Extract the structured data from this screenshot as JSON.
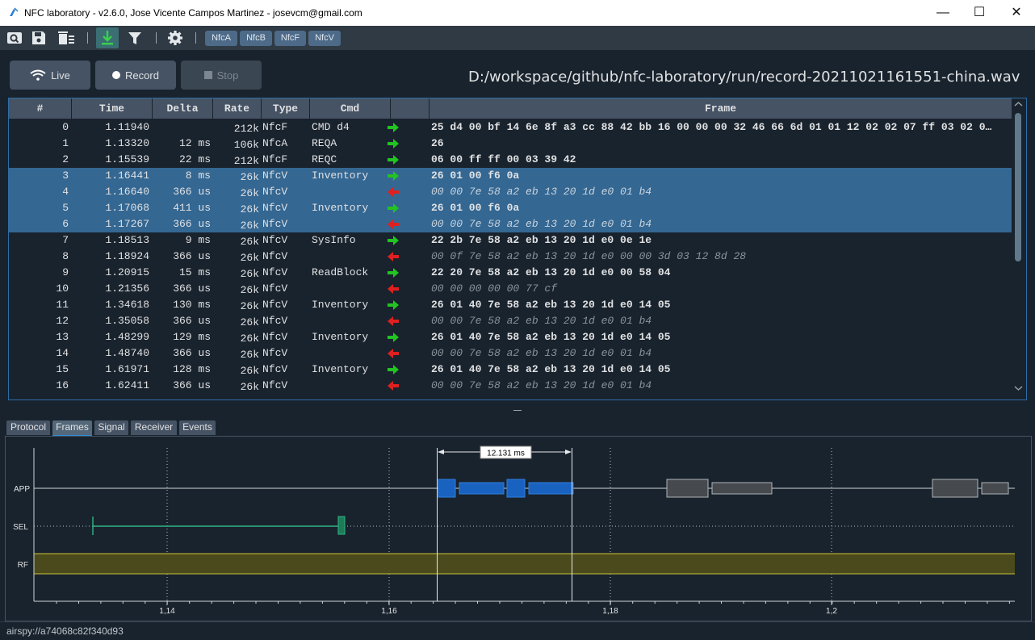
{
  "window": {
    "title": "NFC laboratory - v2.6.0, Jose Vicente Campos Martinez - josevcm@gmail.com",
    "minimize": "—",
    "maximize": "☐",
    "close": "✕"
  },
  "toolbar": {
    "chips": [
      "NfcA",
      "NfcB",
      "NfcF",
      "NfcV"
    ]
  },
  "controls": {
    "live": "Live",
    "record": "Record",
    "stop": "Stop"
  },
  "file_path": "D:/workspace/github/nfc-laboratory/run/record-20211021161551-china.wav",
  "table": {
    "headers": [
      "#",
      "Time",
      "Delta",
      "Rate",
      "Type",
      "Cmd",
      "",
      "Frame"
    ],
    "rows": [
      {
        "num": "0",
        "time": "1.11940",
        "delta": "",
        "rate": "212k",
        "type": "NfcF",
        "cmd": "CMD d4",
        "dir": "out",
        "frame": "25 d4 00 bf 14 6e 8f a3 cc 88 42 bb 16 00 00 00 32 46 66 6d 01 01 12 02 02 07 ff 03 02 0…",
        "selected": false
      },
      {
        "num": "1",
        "time": "1.13320",
        "delta": "12 ms",
        "rate": "106k",
        "type": "NfcA",
        "cmd": "REQA",
        "dir": "out",
        "frame": "26",
        "selected": false
      },
      {
        "num": "2",
        "time": "1.15539",
        "delta": "22 ms",
        "rate": "212k",
        "type": "NfcF",
        "cmd": "REQC",
        "dir": "out",
        "frame": "06 00 ff ff 00 03 39 42",
        "selected": false
      },
      {
        "num": "3",
        "time": "1.16441",
        "delta": "8 ms",
        "rate": "26k",
        "type": "NfcV",
        "cmd": "Inventory",
        "dir": "out",
        "frame": "26 01 00 f6 0a",
        "selected": true
      },
      {
        "num": "4",
        "time": "1.16640",
        "delta": "366 us",
        "rate": "26k",
        "type": "NfcV",
        "cmd": "",
        "dir": "in",
        "frame": "00 00 7e 58 a2 eb 13 20 1d e0 01 b4",
        "selected": true
      },
      {
        "num": "5",
        "time": "1.17068",
        "delta": "411 us",
        "rate": "26k",
        "type": "NfcV",
        "cmd": "Inventory",
        "dir": "out",
        "frame": "26 01 00 f6 0a",
        "selected": true
      },
      {
        "num": "6",
        "time": "1.17267",
        "delta": "366 us",
        "rate": "26k",
        "type": "NfcV",
        "cmd": "",
        "dir": "in",
        "frame": "00 00 7e 58 a2 eb 13 20 1d e0 01 b4",
        "selected": true
      },
      {
        "num": "7",
        "time": "1.18513",
        "delta": "9 ms",
        "rate": "26k",
        "type": "NfcV",
        "cmd": "SysInfo",
        "dir": "out",
        "frame": "22 2b 7e 58 a2 eb 13 20 1d e0 0e 1e",
        "selected": false
      },
      {
        "num": "8",
        "time": "1.18924",
        "delta": "366 us",
        "rate": "26k",
        "type": "NfcV",
        "cmd": "",
        "dir": "in",
        "frame": "00 0f 7e 58 a2 eb 13 20 1d e0 00 00 3d 03 12 8d 28",
        "selected": false
      },
      {
        "num": "9",
        "time": "1.20915",
        "delta": "15 ms",
        "rate": "26k",
        "type": "NfcV",
        "cmd": "ReadBlock",
        "dir": "out",
        "frame": "22 20 7e 58 a2 eb 13 20 1d e0 00 58 04",
        "selected": false
      },
      {
        "num": "10",
        "time": "1.21356",
        "delta": "366 us",
        "rate": "26k",
        "type": "NfcV",
        "cmd": "",
        "dir": "in",
        "frame": "00 00 00 00 00 77 cf",
        "selected": false
      },
      {
        "num": "11",
        "time": "1.34618",
        "delta": "130 ms",
        "rate": "26k",
        "type": "NfcV",
        "cmd": "Inventory",
        "dir": "out",
        "frame": "26 01 40 7e 58 a2 eb 13 20 1d e0 14 05",
        "selected": false
      },
      {
        "num": "12",
        "time": "1.35058",
        "delta": "366 us",
        "rate": "26k",
        "type": "NfcV",
        "cmd": "",
        "dir": "in",
        "frame": "00 00 7e 58 a2 eb 13 20 1d e0 01 b4",
        "selected": false
      },
      {
        "num": "13",
        "time": "1.48299",
        "delta": "129 ms",
        "rate": "26k",
        "type": "NfcV",
        "cmd": "Inventory",
        "dir": "out",
        "frame": "26 01 40 7e 58 a2 eb 13 20 1d e0 14 05",
        "selected": false
      },
      {
        "num": "14",
        "time": "1.48740",
        "delta": "366 us",
        "rate": "26k",
        "type": "NfcV",
        "cmd": "",
        "dir": "in",
        "frame": "00 00 7e 58 a2 eb 13 20 1d e0 01 b4",
        "selected": false
      },
      {
        "num": "15",
        "time": "1.61971",
        "delta": "128 ms",
        "rate": "26k",
        "type": "NfcV",
        "cmd": "Inventory",
        "dir": "out",
        "frame": "26 01 40 7e 58 a2 eb 13 20 1d e0 14 05",
        "selected": false
      },
      {
        "num": "16",
        "time": "1.62411",
        "delta": "366 us",
        "rate": "26k",
        "type": "NfcV",
        "cmd": "",
        "dir": "in",
        "frame": "00 00 7e 58 a2 eb 13 20 1d e0 01 b4",
        "selected": false
      }
    ]
  },
  "tabs": [
    "Protocol",
    "Frames",
    "Signal",
    "Receiver",
    "Events"
  ],
  "active_tab": "Frames",
  "plot": {
    "lanes": [
      "APP",
      "SEL",
      "RF"
    ],
    "x_ticks": [
      "1,14",
      "1,16",
      "1,18",
      "1,2"
    ],
    "measure": "12.131 ms"
  },
  "status": "airspy://a74068c82f340d93",
  "colors": {
    "selection": "#346792",
    "arrow_out": "#22c322",
    "arrow_in": "#e02020",
    "frame_nfcv": "#1a62c0",
    "frame_other": "#464a4e",
    "sel_line": "#2fb584",
    "rf_band": "#4a4a1c"
  }
}
